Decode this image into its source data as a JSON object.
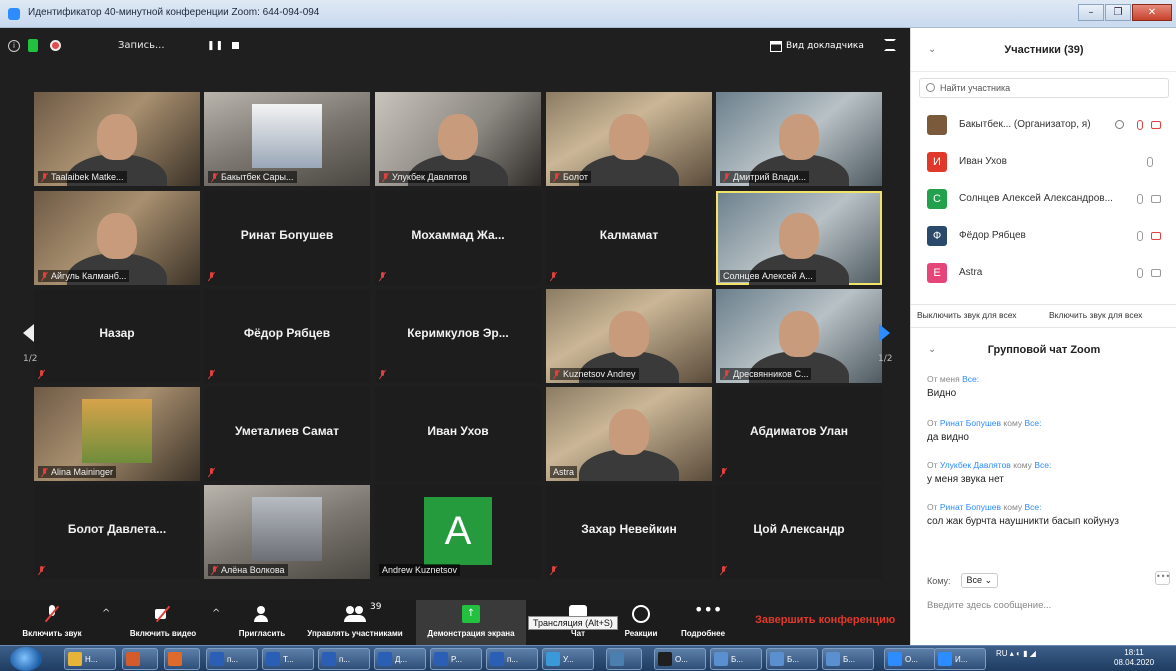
{
  "window": {
    "title": "Идентификатор 40-минутной конференции Zoom: 644-094-094",
    "controls": [
      "–",
      "❐",
      "✕"
    ]
  },
  "top_controls": {
    "record_label": "Запись...",
    "pause_label": "❚❚",
    "speaker_view_label": "Вид докладчика"
  },
  "tiles": [
    {
      "name": "Taalaibek Matke...",
      "video": true,
      "muted": true
    },
    {
      "name": "Бакытбек Сары...",
      "video": true,
      "muted": true
    },
    {
      "name": "Улукбек Давлятов",
      "video": true,
      "muted": true
    },
    {
      "name": "Болот",
      "video": true,
      "muted": true
    },
    {
      "name": "Дмитрий Влади...",
      "video": true,
      "muted": true
    },
    {
      "name": "Айгуль Калманб...",
      "video": true,
      "muted": true
    },
    {
      "name": "Ринат Бопушев",
      "video": false,
      "muted": true
    },
    {
      "name": "Мохаммад Жа...",
      "video": false,
      "muted": true
    },
    {
      "name": "Калмамат",
      "video": false,
      "muted": true
    },
    {
      "name": "Солнцев Алексей А...",
      "video": true,
      "muted": false,
      "active": true
    },
    {
      "name": "Назар",
      "video": false,
      "muted": true
    },
    {
      "name": "Фёдор Рябцев",
      "video": false,
      "muted": true
    },
    {
      "name": "Керимкулов Эр...",
      "video": false,
      "muted": true
    },
    {
      "name": "Kuznetsov Andrey",
      "video": true,
      "muted": true
    },
    {
      "name": "Дресвянников С...",
      "video": true,
      "muted": true
    },
    {
      "name": "Alina Maininger",
      "video": true,
      "muted": true
    },
    {
      "name": "Уметалиев Самат",
      "video": false,
      "muted": true
    },
    {
      "name": "Иван Ухов",
      "video": false,
      "muted": false
    },
    {
      "name": "Astra",
      "video": true,
      "muted": false
    },
    {
      "name": "Абдиматов Улан",
      "video": false,
      "muted": true
    },
    {
      "name": "Болот Давлета...",
      "video": false,
      "muted": true
    },
    {
      "name": "Алёна Волкова",
      "video": true,
      "muted": true
    },
    {
      "name": "Andrew Kuznetsov",
      "video": false,
      "muted": false,
      "avatar_letter": "A"
    },
    {
      "name": "Захар Невейкин",
      "video": false,
      "muted": true
    },
    {
      "name": "Цой Александр",
      "video": false,
      "muted": true
    }
  ],
  "pager": {
    "left": "1/2",
    "right": "1/2"
  },
  "toolbar": {
    "unmute": "Включить звук",
    "start_video": "Включить видео",
    "invite": "Пригласить",
    "manage": "Управлять участниками",
    "participants_count": "39",
    "share": "Демонстрация экрана",
    "chat": "Чат",
    "reactions": "Реакции",
    "more": "Подробнее",
    "end": "Завершить конференцию",
    "tooltip": "Трансляция (Alt+S)"
  },
  "participants_panel": {
    "title": "Участники (39)",
    "search_placeholder": "Найти участника",
    "rows": [
      {
        "name": "Бакытбек... (Организатор, я)",
        "avatar": "",
        "color": "#7a5a3a"
      },
      {
        "name": "Иван Ухов",
        "avatar": "И",
        "color": "#e0392b"
      },
      {
        "name": "Солнцев Алексей Александров...",
        "avatar": "С",
        "color": "#23a04c"
      },
      {
        "name": "Фёдор Рябцев",
        "avatar": "Ф",
        "color": "#2b4a6b"
      },
      {
        "name": "Astra",
        "avatar": "E",
        "color": "#e6457a"
      }
    ],
    "mute_all": "Выключить звук для всех",
    "unmute_all": "Включить звук для всех"
  },
  "chat_panel": {
    "title": "Групповой чат Zoom",
    "messages": [
      {
        "from": "От меня",
        "to": "Все:",
        "text": "Видно"
      },
      {
        "from": "Ринат Бопушев",
        "to": "Все:",
        "text": "да видно"
      },
      {
        "from": "Улукбек Давлятов",
        "to": "Все:",
        "text": "у меня звука нет"
      },
      {
        "from": "Ринат Бопушев",
        "to": "Все:",
        "text": "сол жак бурчта наушникти басып койунуз"
      }
    ],
    "from_word": "От",
    "to_word": "кому",
    "to_label": "Кому:",
    "to_value": "Все",
    "input_placeholder": "Введите здесь сообщение..."
  },
  "taskbar": {
    "items": [
      "H...",
      "",
      "",
      "п...",
      "T...",
      "п...",
      "Д...",
      "P...",
      "п...",
      "У...",
      "",
      "O...",
      "Б...",
      "Б...",
      "Б...",
      "O...",
      "И..."
    ],
    "lang": "RU",
    "time": "18:11",
    "date": "08.04.2020"
  }
}
